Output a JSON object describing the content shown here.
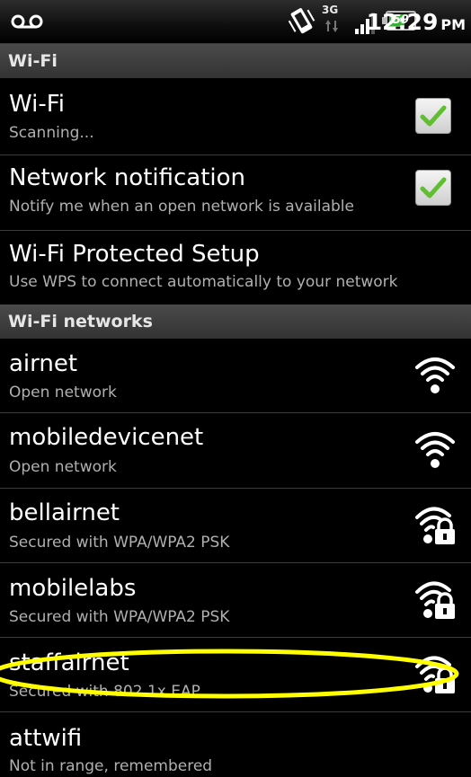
{
  "status_bar": {
    "voicemail_icon": "voicemail-icon",
    "vibrate_icon": "vibrate-icon",
    "network_type": "3G",
    "signal_icon": "signal-icon",
    "battery_level": "59",
    "time": "12:29",
    "ampm": "PM"
  },
  "wifi_section": {
    "header": "Wi-Fi",
    "wifi": {
      "title": "Wi-Fi",
      "summary": "Scanning...",
      "checked": true
    },
    "notification": {
      "title": "Network notification",
      "summary": "Notify me when an open network is available",
      "checked": true
    },
    "wps": {
      "title": "Wi-Fi Protected Setup",
      "summary": "Use WPS to connect automatically to your network"
    }
  },
  "networks_section": {
    "header": "Wi-Fi networks",
    "networks": [
      {
        "ssid": "airnet",
        "status": "Open network",
        "icon": "wifi-open-icon"
      },
      {
        "ssid": "mobiledevicenet",
        "status": "Open network",
        "icon": "wifi-open-icon"
      },
      {
        "ssid": "bellairnet",
        "status": "Secured with WPA/WPA2 PSK",
        "icon": "wifi-locked-icon"
      },
      {
        "ssid": "mobilelabs",
        "status": "Secured with WPA/WPA2 PSK",
        "icon": "wifi-locked-icon"
      },
      {
        "ssid": "staffairnet",
        "status": "Secured with 802.1x EAP",
        "icon": "wifi-locked-icon"
      },
      {
        "ssid": "attwifi",
        "status": "Not in range, remembered"
      }
    ]
  },
  "colors": {
    "highlight": "#ffff00",
    "check_green": "#5fbf2f"
  }
}
